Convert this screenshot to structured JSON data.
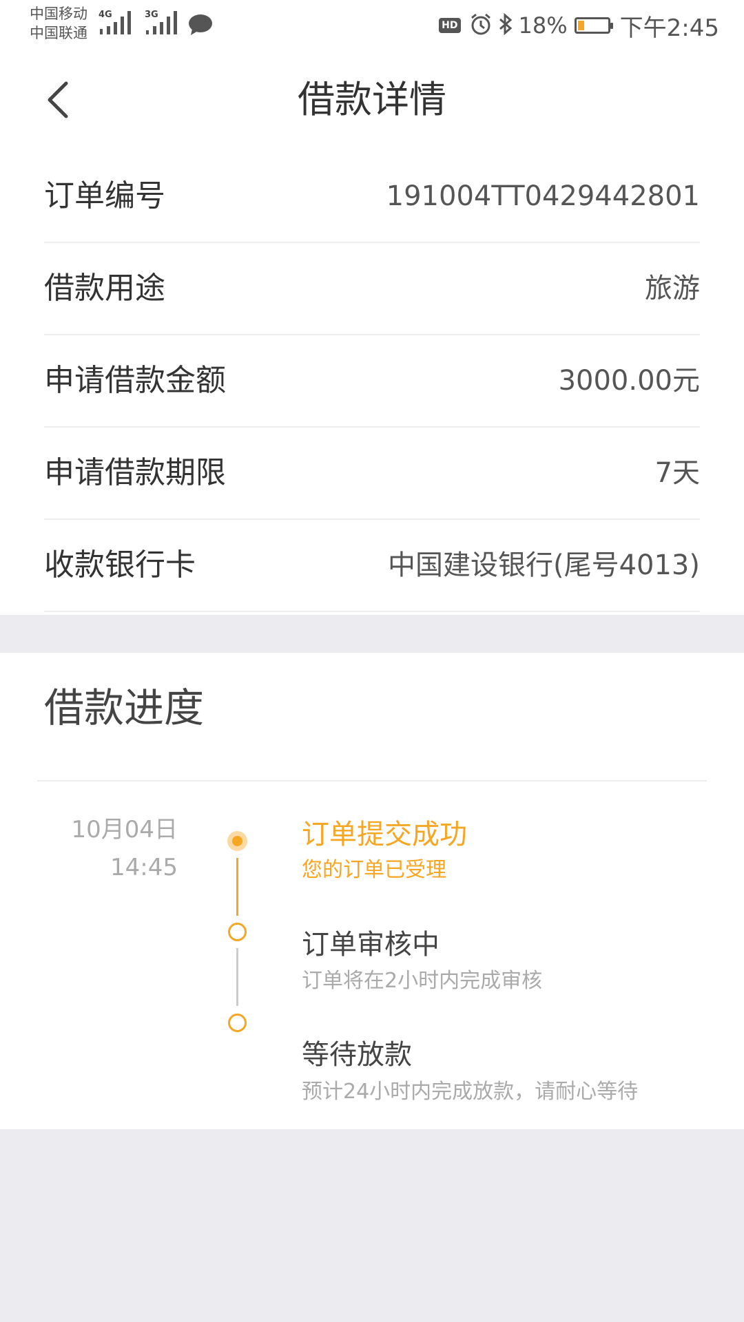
{
  "status_bar": {
    "carrier_1": "中国移动",
    "carrier_2": "中国联通",
    "network_1": "4G",
    "network_2": "3G",
    "hd_badge": "HD",
    "battery_percent": "18%",
    "time": "下午2:45",
    "icons": [
      "signal-icon",
      "chat-bubble-icon",
      "alarm-icon",
      "bluetooth-icon",
      "battery-icon"
    ]
  },
  "nav": {
    "title": "借款详情",
    "back_icon": "chevron-left-icon"
  },
  "details": [
    {
      "label": "订单编号",
      "value": "191004TT0429442801"
    },
    {
      "label": "借款用途",
      "value": "旅游"
    },
    {
      "label": "申请借款金额",
      "value": "3000.00元"
    },
    {
      "label": "申请借款期限",
      "value": "7天"
    },
    {
      "label": "收款银行卡",
      "value": "中国建设银行(尾号4013)"
    }
  ],
  "progress": {
    "title": "借款进度",
    "steps": [
      {
        "date": "10月04日",
        "time": "14:45",
        "title": "订单提交成功",
        "subtitle": "您的订单已受理",
        "state": "done"
      },
      {
        "date": "",
        "time": "",
        "title": "订单审核中",
        "subtitle": "订单将在2小时内完成审核",
        "state": "pending"
      },
      {
        "date": "",
        "time": "",
        "title": "等待放款",
        "subtitle": "预计24小时内完成放款，请耐心等待",
        "state": "pending"
      }
    ]
  },
  "colors": {
    "accent": "#f5a623",
    "accent_light": "#fbd9a3",
    "text_primary": "#333333",
    "text_secondary": "#aaaaaa",
    "page_background": "#ebebf0",
    "timeline_gray": "#cccccc"
  }
}
